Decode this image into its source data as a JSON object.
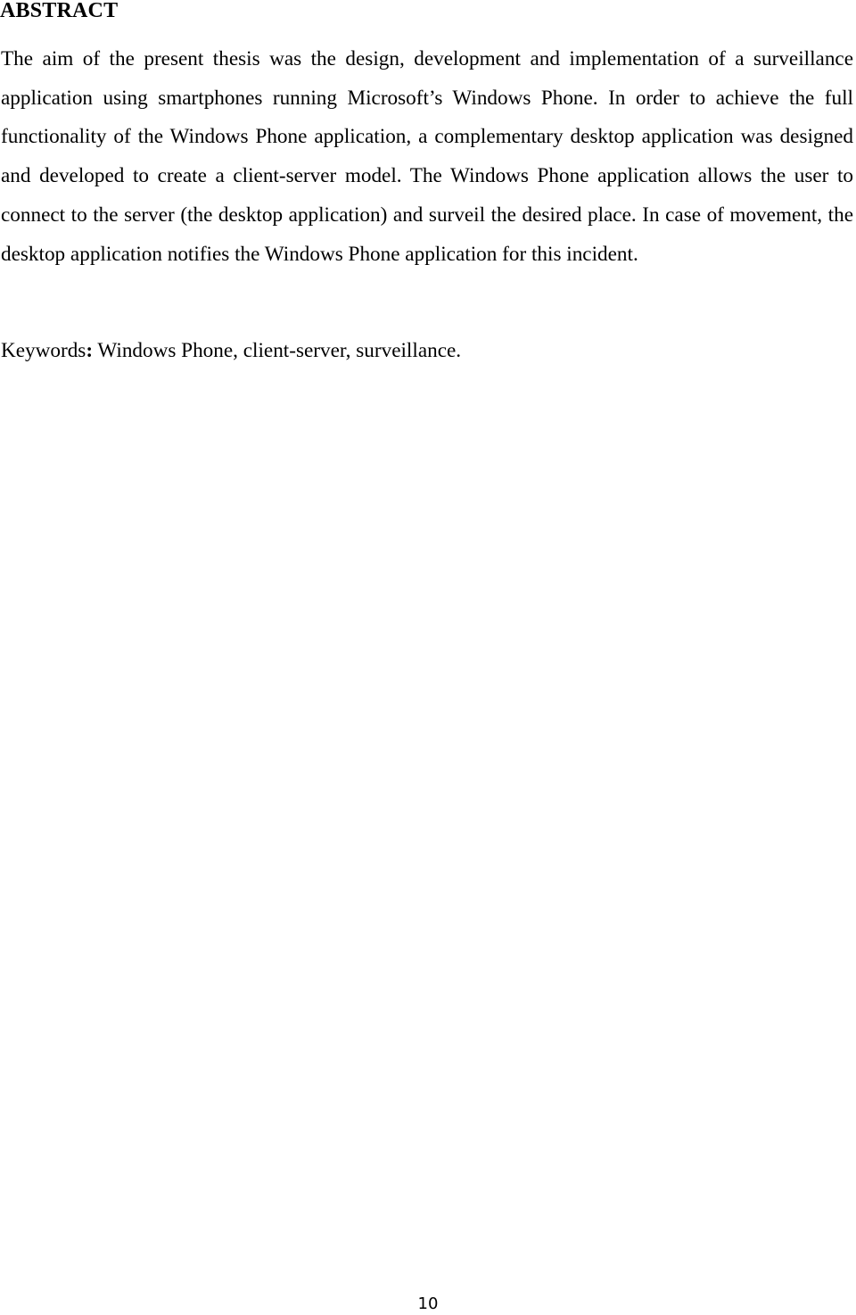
{
  "document": {
    "heading": "ABSTRACT",
    "abstract_text": "The aim of the present thesis was the design, development and implementation of a surveillance application using smartphones running Microsoft’s Windows Phone. In order to achieve the full functionality of the Windows Phone application, a complementary desktop application was designed and developed to create a client-server model. The Windows Phone application allows the user to connect to the server (the desktop application) and surveil the desired place. In case of movement, the desktop application notifies the Windows Phone application for this incident.",
    "keywords_label": "Keywords",
    "keywords_colon": ":",
    "keywords_value": " Windows Phone, client-server, surveillance.",
    "page_number": "10"
  }
}
